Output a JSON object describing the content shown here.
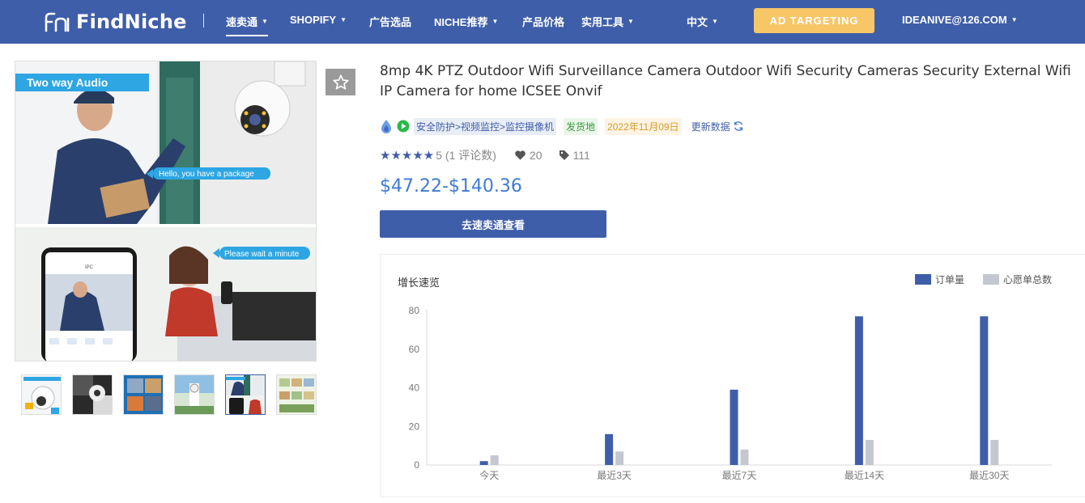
{
  "nav": {
    "brand": "FindNiche",
    "items": [
      {
        "label": "速卖通",
        "caret": true,
        "active": true
      },
      {
        "label": "SHOPIFY",
        "caret": true
      },
      {
        "label": "广告选品",
        "caret": false
      },
      {
        "label": "NICHE推荐",
        "caret": true
      },
      {
        "label": "产品价格",
        "caret": false
      },
      {
        "label": "实用工具",
        "caret": true
      }
    ],
    "language": "中文",
    "ad_button": "AD TARGETING",
    "account": "IDEANIVE@126.COM"
  },
  "gallery": {
    "callouts": {
      "top": "Two way Audio",
      "bubble1": "Hello, you have a package",
      "bubble2": "Please wait a minute",
      "phone_header": "IPC"
    },
    "thumbnail_count": 6,
    "active_thumbnail_index": 4
  },
  "product": {
    "title": "8mp 4K PTZ Outdoor Wifi Surveillance Camera Outdoor Wifi Security Cameras Security External Wifi IP Camera for home ICSEE Onvif",
    "category": "安全防护>视频监控>监控摄像机",
    "ship_from": "发货地",
    "date": "2022年11月09日",
    "update_label": "更新数据",
    "rating_value": 5,
    "rating_text": "5 (1 评论数)",
    "likes": "20",
    "tags_count": "111",
    "price": "$47.22-$140.36",
    "cta_label": "去速卖通查看"
  },
  "colors": {
    "brand": "#3f5ea9",
    "accent_yellow": "#f6c667",
    "price": "#3f7bd4",
    "series_orders": "#3f5ea9",
    "series_wishlist": "#c4c7cf"
  },
  "chart_data": {
    "type": "bar",
    "title": "增长速览",
    "categories": [
      "今天",
      "最近3天",
      "最近7天",
      "最近14天",
      "最近30天"
    ],
    "series": [
      {
        "name": "订单量",
        "values": [
          2,
          16,
          39,
          77,
          77
        ]
      },
      {
        "name": "心愿单总数",
        "values": [
          5,
          7,
          8,
          13,
          13
        ]
      }
    ],
    "ylim": [
      0,
      80
    ],
    "yticks": [
      0,
      20,
      40,
      60,
      80
    ],
    "legend_position": "top-right",
    "grid": false
  }
}
